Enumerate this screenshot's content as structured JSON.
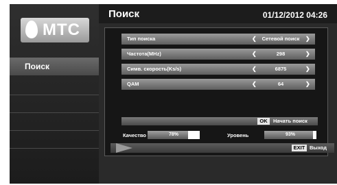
{
  "brand": {
    "logo_text": "МТС"
  },
  "sidebar": {
    "items": [
      {
        "label": "Поиск",
        "selected": true
      }
    ]
  },
  "header": {
    "title": "Поиск",
    "datetime": "01/12/2012 04:26"
  },
  "settings": [
    {
      "label": "Тип поиска",
      "value": "Сетевой поиск"
    },
    {
      "label": "Частота(MHz)",
      "value": "298"
    },
    {
      "label": "Симв. скорость(Ks/s)",
      "value": "6875"
    },
    {
      "label": "QAM",
      "value": "64"
    }
  ],
  "actions": {
    "ok_key": "OK",
    "ok_label": "Начать поиск",
    "exit_key": "EXIT",
    "exit_label": "Выход"
  },
  "meters": {
    "quality": {
      "label": "Качество",
      "value_text": "78%",
      "level": 0.78
    },
    "level": {
      "label": "Уровень",
      "value_text": "93%",
      "level": 0.93
    }
  },
  "colors": {
    "background": "#ffffff",
    "panel": "#161616",
    "bar_gradient_top": "#9a9a9a",
    "bar_gradient_bottom": "#5e5e5e"
  }
}
